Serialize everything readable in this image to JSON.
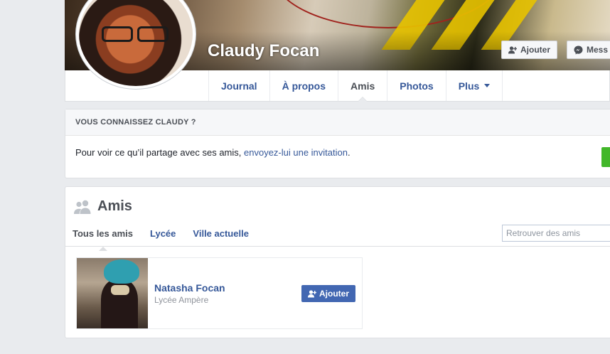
{
  "profile": {
    "name": "Claudy Focan",
    "cover_actions": {
      "add_label": "Ajouter",
      "message_label": "Mess"
    }
  },
  "nav": {
    "tabs": [
      {
        "label": "Journal"
      },
      {
        "label": "À propos"
      },
      {
        "label": "Amis"
      },
      {
        "label": "Photos"
      },
      {
        "label": "Plus"
      }
    ],
    "active_tab": "Amis"
  },
  "know_card": {
    "heading": "VOUS CONNAISSEZ CLAUDY ?",
    "body_text": "Pour voir ce qu’il partage avec ses amis, ",
    "link_text": "envoyez-lui une invitation",
    "body_end": "."
  },
  "friends": {
    "title": "Amis",
    "tabs": [
      {
        "label": "Tous les amis"
      },
      {
        "label": "Lycée"
      },
      {
        "label": "Ville actuelle"
      }
    ],
    "search_placeholder": "Retrouver des amis",
    "list": [
      {
        "name": "Natasha Focan",
        "subtitle": "Lycée Ampère",
        "button_label": "Ajouter"
      }
    ]
  },
  "colors": {
    "link": "#365899",
    "primary_button": "#4267b2",
    "background": "#e9ebee",
    "green_button": "#42b72a"
  }
}
